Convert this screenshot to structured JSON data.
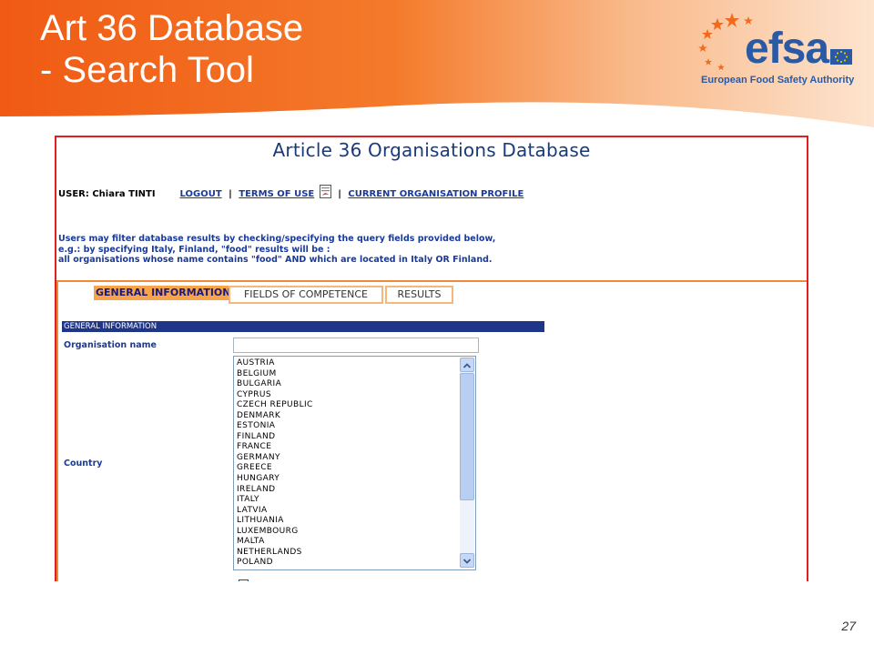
{
  "slide": {
    "title_line1": "Art 36 Database",
    "title_line2": "- Search Tool",
    "page_number": "27"
  },
  "logo": {
    "name": "efsa",
    "tagline": "European Food Safety Authority"
  },
  "app": {
    "title": "Article 36 Organisations Database",
    "user_label": "USER: Chiara TINTI",
    "links": {
      "logout": "LOGOUT",
      "terms": "TERMS OF USE",
      "profile": "CURRENT ORGANISATION PROFILE"
    },
    "separator": "|",
    "info_lines": [
      "Users may filter database results by checking/specifying the query fields provided below,",
      "e.g.: by specifying Italy, Finland, \"food\" results will be :",
      "all organisations whose name contains \"food\" AND which are located in Italy OR Finland."
    ],
    "tabs": {
      "general": "GENERAL INFORMATION",
      "fields": "FIELDS OF COMPETENCE",
      "results": "RESULTS"
    },
    "section_title": "GENERAL INFORMATION",
    "form": {
      "org_name_label": "Organisation name",
      "org_name_value": "",
      "country_label": "Country",
      "countries": [
        "AUSTRIA",
        "BELGIUM",
        "BULGARIA",
        "CYPRUS",
        "CZECH REPUBLIC",
        "DENMARK",
        "ESTONIA",
        "FINLAND",
        "FRANCE",
        "GERMANY",
        "GREECE",
        "HUNGARY",
        "IRELAND",
        "ITALY",
        "LATVIA",
        "LITHUANIA",
        "LUXEMBOURG",
        "MALTA",
        "NETHERLANDS",
        "POLAND"
      ]
    }
  },
  "colors": {
    "accent_orange": "#f26a1b",
    "efsa_blue": "#2b5aa5",
    "nav_blue": "#1f3588",
    "frame_red": "#e02020"
  }
}
